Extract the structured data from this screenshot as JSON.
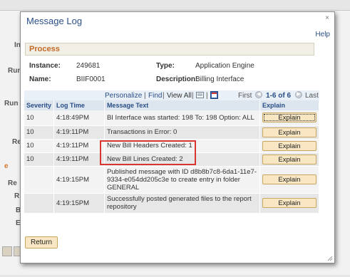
{
  "background": {
    "labels": [
      "In",
      "Run",
      "Run",
      "Re",
      "e",
      "Re",
      "R",
      "B",
      "E"
    ]
  },
  "modal": {
    "title": "Message Log",
    "close_icon": "close-icon",
    "help": "Help",
    "section_title": "Process",
    "fields": {
      "instance_label": "Instance:",
      "instance_value": "249681",
      "type_label": "Type:",
      "type_value": "Application Engine",
      "name_label": "Name:",
      "name_value": "BIIF0001",
      "description_label": "Description:",
      "description_value": "Billing Interface"
    },
    "grid_nav": {
      "personalize": "Personalize",
      "sep1": "|",
      "find": "Find",
      "sep2": "|",
      "view_all": "View All",
      "sep3": "|",
      "first": "First",
      "range": "1-6 of 6",
      "last": "Last"
    },
    "columns": [
      "Severity",
      "Log Time",
      "Message Text",
      "Explain"
    ],
    "rows": [
      {
        "severity": "10",
        "time": "4:18:49PM",
        "message": "BI Interface was started: 198 To: 198  Option: ALL",
        "explain": "Explain"
      },
      {
        "severity": "10",
        "time": "4:19:11PM",
        "message": "Transactions in Error: 0",
        "explain": "Explain"
      },
      {
        "severity": "10",
        "time": "4:19:11PM",
        "message": "New Bill Headers Created:  1",
        "explain": "Explain"
      },
      {
        "severity": "10",
        "time": "4:19:11PM",
        "message": "New Bill Lines Created: 2",
        "explain": "Explain"
      },
      {
        "severity": "",
        "time": "4:19:15PM",
        "message": "Published message with ID d8b8b7c8-6da1-11e7-9334-e054dd205c3e to create entry in folder GENERAL",
        "explain": "Explain"
      },
      {
        "severity": "",
        "time": "4:19:15PM",
        "message": "Successfully posted generated files to the report repository",
        "explain": "Explain"
      }
    ],
    "return_label": "Return"
  },
  "colors": {
    "link": "#2a4f87",
    "section": "#c56a25",
    "highlight": "#d9362f",
    "button_bg": "#f8e7c2"
  }
}
